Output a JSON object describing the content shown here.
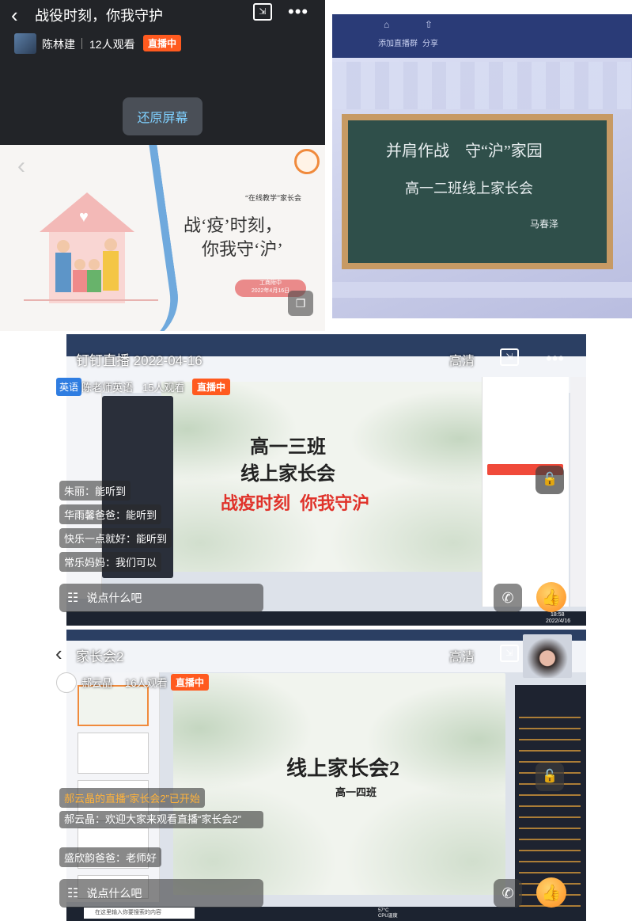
{
  "panel1": {
    "title": "战役时刻，你我守护",
    "host": "陈林建",
    "viewers": "12人观看",
    "live_badge": "直播中",
    "restore_button": "还原屏幕",
    "slide": {
      "subtitle": "“在线教学”家长会",
      "title_line1": "战‘疫’时刻，",
      "title_line2": "你我守‘沪’",
      "school": "工商附中",
      "date": "2022年4月16日"
    }
  },
  "panel2": {
    "toolbar_add": "添加直播群",
    "toolbar_share": "分享",
    "title_line1": "并肩作战　守“沪”家园",
    "title_line2": "高一二班线上家长会",
    "author": "马春泽"
  },
  "panel3": {
    "title": "钉钉直播 2022-04-16",
    "hd": "高清",
    "subject_badge": "英语",
    "host": "陈老师英语",
    "viewers": "15人观看",
    "live_badge": "直播中",
    "slide_line1": "高一三班",
    "slide_line2": "线上家长会",
    "slide_line3": "战疫时刻  你我守沪",
    "chats": [
      {
        "user": "朱丽",
        "msg": "能听到"
      },
      {
        "user": "华雨馨爸爸",
        "msg": "能听到"
      },
      {
        "user": "快乐一点就好",
        "msg": "能听到"
      },
      {
        "user": "常乐妈妈",
        "msg": "我们可以"
      }
    ],
    "say_placeholder": "说点什么吧",
    "clock_time": "18:58",
    "clock_date": "2022/4/16"
  },
  "panel4": {
    "title": "家长会2",
    "hd": "高清",
    "host": "郝云晶",
    "viewers": "16人观看",
    "live_badge": "直播中",
    "slide_line1": "线上家长会2",
    "slide_line2": "高一四班",
    "notice": "郝云晶的直播“家长会2”已开始",
    "chats": [
      {
        "user": "郝云晶",
        "msg": "欢迎大家来观看直播“家长会2”"
      },
      {
        "user": "盛欣韵爸爸",
        "msg": "老师好"
      }
    ],
    "say_placeholder": "说点什么吧",
    "search_placeholder": "在这里输入你要搜索的内容",
    "weather": "57°C CPU温度"
  },
  "colors": {
    "live_orange": "#ff5a1f",
    "slide_red": "#e0322a",
    "chalkboard": "#2f4f4a"
  }
}
